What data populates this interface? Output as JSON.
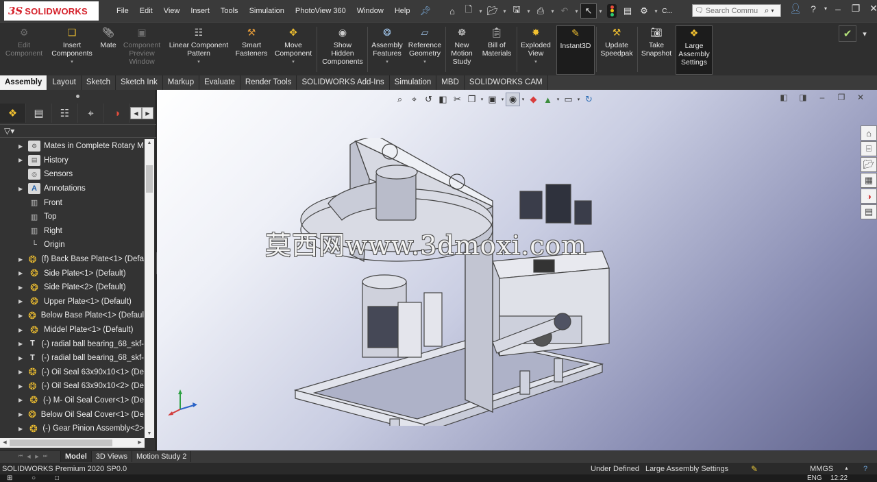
{
  "app": {
    "logo_ds": "3S",
    "logo_name": "SOLIDWORKS"
  },
  "menubar": {
    "items": [
      "File",
      "Edit",
      "View",
      "Insert",
      "Tools",
      "Simulation",
      "PhotoView 360",
      "Window",
      "Help"
    ],
    "pin_icon": "pin-icon",
    "search_placeholder": "Search Commu",
    "tools_overflow": "C..."
  },
  "command_manager": {
    "tools": [
      {
        "label": "Edit\nComponent",
        "icon": "edit-component-icon",
        "disabled": true
      },
      {
        "label": "Insert\nComponents",
        "icon": "insert-components-icon",
        "disabled": false,
        "dropdown": true
      },
      {
        "label": "Mate",
        "icon": "mate-icon",
        "disabled": false
      },
      {
        "label": "Component\nPreview\nWindow",
        "icon": "component-preview-icon",
        "disabled": true
      },
      {
        "label": "Linear Component\nPattern",
        "icon": "linear-pattern-icon",
        "disabled": false,
        "dropdown": true
      },
      {
        "label": "Smart\nFasteners",
        "icon": "smart-fasteners-icon",
        "disabled": false
      },
      {
        "label": "Move\nComponent",
        "icon": "move-component-icon",
        "disabled": false,
        "dropdown": true
      },
      {
        "label": "Show\nHidden\nComponents",
        "icon": "show-hidden-icon",
        "disabled": false
      },
      {
        "label": "Assembly\nFeatures",
        "icon": "assembly-features-icon",
        "disabled": false,
        "dropdown": true
      },
      {
        "label": "Reference\nGeometry",
        "icon": "reference-geometry-icon",
        "disabled": false,
        "dropdown": true
      },
      {
        "label": "New\nMotion\nStudy",
        "icon": "motion-study-icon",
        "disabled": false
      },
      {
        "label": "Bill of\nMaterials",
        "icon": "bill-of-materials-icon",
        "disabled": false
      },
      {
        "label": "Exploded\nView",
        "icon": "exploded-view-icon",
        "disabled": false,
        "dropdown": true
      },
      {
        "label": "Instant3D",
        "icon": "instant3d-icon",
        "disabled": false,
        "active": true
      },
      {
        "label": "Update\nSpeedpak",
        "icon": "speedpak-icon",
        "disabled": false
      },
      {
        "label": "Take\nSnapshot",
        "icon": "snapshot-icon",
        "disabled": false
      },
      {
        "label": "Large\nAssembly\nSettings",
        "icon": "large-assembly-icon",
        "disabled": false,
        "active": true
      }
    ]
  },
  "tabs": {
    "items": [
      "Assembly",
      "Layout",
      "Sketch",
      "Sketch Ink",
      "Markup",
      "Evaluate",
      "Render Tools",
      "SOLIDWORKS Add-Ins",
      "Simulation",
      "MBD",
      "SOLIDWORKS CAM"
    ],
    "active": "Assembly"
  },
  "feature_tree": {
    "nodes": [
      {
        "label": "Mates in Complete Rotary M",
        "icon": "mates-folder-icon",
        "expandable": true
      },
      {
        "label": "History",
        "icon": "history-folder-icon",
        "expandable": true
      },
      {
        "label": "Sensors",
        "icon": "sensors-icon",
        "expandable": false
      },
      {
        "label": "Annotations",
        "icon": "annotations-icon",
        "expandable": true
      },
      {
        "label": "Front",
        "icon": "plane-icon",
        "expandable": false
      },
      {
        "label": "Top",
        "icon": "plane-icon",
        "expandable": false
      },
      {
        "label": "Right",
        "icon": "plane-icon",
        "expandable": false
      },
      {
        "label": "Origin",
        "icon": "origin-icon",
        "expandable": false
      },
      {
        "label": "(f) Back Base Plate<1> (Defa",
        "icon": "part-icon",
        "expandable": true
      },
      {
        "label": "Side Plate<1> (Default)",
        "icon": "part-icon",
        "expandable": true
      },
      {
        "label": "Side Plate<2> (Default)",
        "icon": "part-icon",
        "expandable": true
      },
      {
        "label": "Upper Plate<1> (Default)",
        "icon": "part-icon",
        "expandable": true
      },
      {
        "label": "Below Base Plate<1> (Defaul",
        "icon": "part-icon",
        "expandable": true
      },
      {
        "label": "Middel Plate<1> (Default)",
        "icon": "part-icon",
        "expandable": true
      },
      {
        "label": "(-) radial ball bearing_68_skf-",
        "icon": "toolbox-part-icon",
        "expandable": true
      },
      {
        "label": "(-) radial ball bearing_68_skf-",
        "icon": "toolbox-part-icon",
        "expandable": true
      },
      {
        "label": "(-) Oil Seal 63x90x10<1> (De",
        "icon": "part-icon",
        "expandable": true
      },
      {
        "label": "(-) Oil Seal 63x90x10<2> (De",
        "icon": "part-icon",
        "expandable": true
      },
      {
        "label": "(-) M- Oil Seal Cover<1> (De",
        "icon": "part-icon",
        "expandable": true
      },
      {
        "label": "Below Oil Seal Cover<1> (De",
        "icon": "part-icon",
        "expandable": true
      },
      {
        "label": "(-) Gear Pinion Assembly<2>",
        "icon": "part-icon",
        "expandable": true
      }
    ]
  },
  "viewport": {
    "watermark": "莫西网www.3dmoxi.com",
    "background_top": "#ffffff",
    "background_bottom": "#62658e"
  },
  "bottom_tabs": {
    "items": [
      "Model",
      "3D Views",
      "Motion Study 2"
    ],
    "active": "Model"
  },
  "status": {
    "version": "SOLIDWORKS Premium 2020 SP0.0",
    "defined": "Under Defined",
    "large_assembly": "Large Assembly Settings",
    "units": "MMGS",
    "caret": "▲",
    "help": "?"
  },
  "taskbar": {
    "lang": "ENG",
    "time": "12:22"
  },
  "colors": {
    "accent": "#d5202a",
    "part_icon": "#f2c130",
    "ui_dark": "#2f2f2f"
  }
}
